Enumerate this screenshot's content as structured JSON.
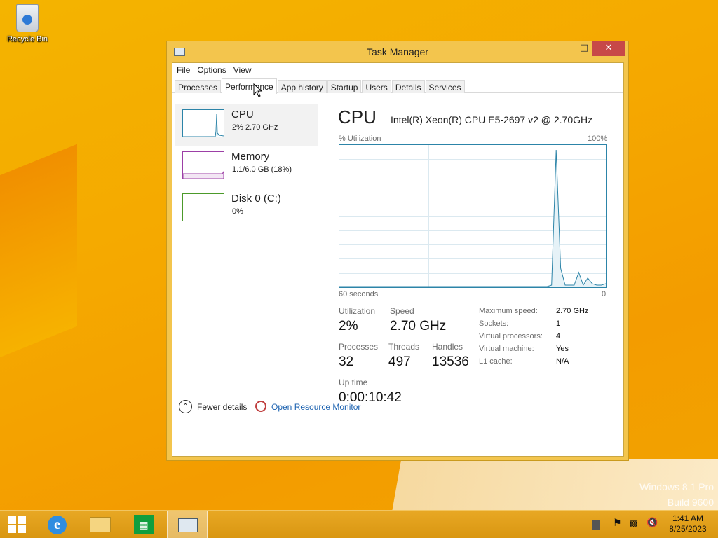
{
  "desktop": {
    "recycle_bin_label": "Recycle Bin",
    "watermark_line1": "Windows 8.1 Pro",
    "watermark_line2": "Build 9600"
  },
  "window": {
    "title": "Task Manager",
    "minimize": "–",
    "maximize": "□",
    "close": "✕"
  },
  "menu": [
    "File",
    "Options",
    "View"
  ],
  "tabs": [
    "Processes",
    "Performance",
    "App history",
    "Startup",
    "Users",
    "Details",
    "Services"
  ],
  "active_tab": "Performance",
  "resources": [
    {
      "name": "CPU",
      "sub": "2%  2.70 GHz"
    },
    {
      "name": "Memory",
      "sub": "1.1/6.0 GB (18%)"
    },
    {
      "name": "Disk 0 (C:)",
      "sub": "0%"
    }
  ],
  "detail": {
    "title": "CPU",
    "model": "Intel(R) Xeon(R) CPU E5-2697 v2 @ 2.70GHz",
    "graph_label": "% Utilization",
    "graph_max": "100%",
    "graph_time": "60 seconds",
    "graph_min": "0",
    "utilization_label": "Utilization",
    "utilization": "2%",
    "speed_label": "Speed",
    "speed": "2.70 GHz",
    "processes_label": "Processes",
    "processes": "32",
    "threads_label": "Threads",
    "threads": "497",
    "handles_label": "Handles",
    "handles": "13536",
    "uptime_label": "Up time",
    "uptime": "0:00:10:42",
    "specs": [
      {
        "k": "Maximum speed:",
        "v": "2.70 GHz"
      },
      {
        "k": "Sockets:",
        "v": "1"
      },
      {
        "k": "Virtual processors:",
        "v": "4"
      },
      {
        "k": "Virtual machine:",
        "v": "Yes"
      },
      {
        "k": "L1 cache:",
        "v": "N/A"
      }
    ]
  },
  "cpu_history_percent": [
    0,
    0,
    0,
    0,
    0,
    0,
    0,
    0,
    0,
    0,
    0,
    0,
    0,
    0,
    0,
    0,
    0,
    0,
    0,
    0,
    0,
    0,
    0,
    0,
    0,
    0,
    0,
    0,
    0,
    0,
    0,
    0,
    0,
    0,
    0,
    0,
    0,
    0,
    0,
    0,
    0,
    0,
    0,
    0,
    0,
    0,
    0,
    1,
    97,
    13,
    1,
    1,
    1,
    10,
    1,
    6,
    2,
    1,
    1,
    2
  ],
  "footer": {
    "fewer_details": "Fewer details",
    "open_resource_monitor": "Open Resource Monitor"
  },
  "taskbar": {
    "time": "1:41 AM",
    "date": "8/25/2023"
  }
}
